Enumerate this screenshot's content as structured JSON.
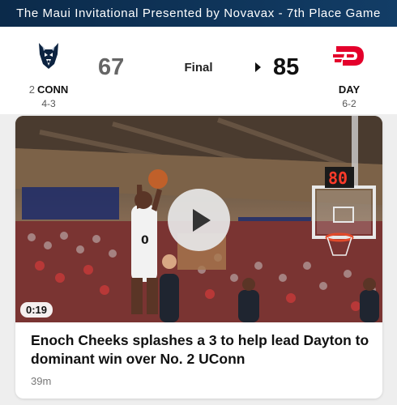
{
  "header": {
    "title": "The Maui Invitational Presented by Novavax - 7th Place Game"
  },
  "game": {
    "status": "Final",
    "away": {
      "rank": "2",
      "abbr": "CONN",
      "record": "4-3",
      "score": "67",
      "logo": "uconn-husky-logo"
    },
    "home": {
      "abbr": "DAY",
      "record": "6-2",
      "score": "85",
      "logo": "dayton-flyers-logo",
      "color": "#e4002b"
    }
  },
  "video": {
    "duration": "0:19",
    "headline": "Enoch Cheeks splashes a 3 to help lead Dayton to dominant win over No. 2 UConn",
    "time_ago": "39m",
    "scoreboard_digits": "80"
  },
  "colors": {
    "header_bg": "#0b2a4a",
    "dayton_red": "#e4002b",
    "uconn_navy": "#0c2340"
  }
}
